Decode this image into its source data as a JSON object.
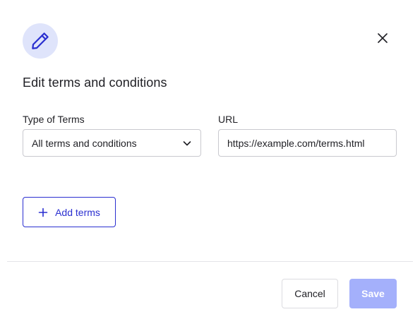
{
  "dialog": {
    "title": "Edit terms and conditions",
    "header_icon": "pencil-icon",
    "close_icon": "close-icon"
  },
  "form": {
    "type_label": "Type of Terms",
    "type_value": "All terms and conditions",
    "url_label": "URL",
    "url_value": "https://example.com/terms.html",
    "add_terms_label": "Add terms"
  },
  "footer": {
    "cancel_label": "Cancel",
    "save_label": "Save",
    "save_enabled": false
  },
  "colors": {
    "accent": "#2a2fd0",
    "icon_bg": "#dfe4fb",
    "save_disabled": "#a4b0fb"
  }
}
